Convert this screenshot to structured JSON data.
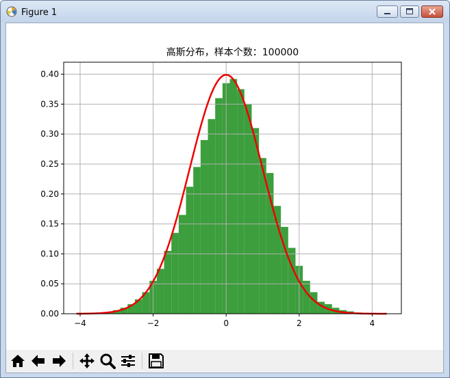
{
  "window": {
    "title": "Figure 1"
  },
  "toolbar": {
    "buttons": [
      {
        "name": "home",
        "icon": "home-icon"
      },
      {
        "name": "back",
        "icon": "arrow-left-icon"
      },
      {
        "name": "forward",
        "icon": "arrow-right-icon"
      },
      {
        "name": "pan",
        "icon": "move-icon"
      },
      {
        "name": "zoom",
        "icon": "magnifier-icon"
      },
      {
        "name": "configure-subplots",
        "icon": "sliders-icon"
      },
      {
        "name": "save",
        "icon": "floppy-icon"
      }
    ]
  },
  "colors": {
    "bars": "#3c9e3c",
    "curve": "#ee0000",
    "grid": "#b0b0b0"
  },
  "chart_data": {
    "type": "bar",
    "title": "高斯分布，样本个数：100000",
    "xlabel": "",
    "ylabel": "",
    "xlim": [
      -4.45,
      4.8
    ],
    "ylim": [
      0.0,
      0.42
    ],
    "xticks": [
      -4,
      -2,
      0,
      2,
      4
    ],
    "yticks": [
      0.0,
      0.05,
      0.1,
      0.15,
      0.2,
      0.25,
      0.3,
      0.35,
      0.4
    ],
    "ytick_labels": [
      "0.00",
      "0.05",
      "0.10",
      "0.15",
      "0.20",
      "0.25",
      "0.30",
      "0.35",
      "0.40"
    ],
    "grid": true,
    "bins": {
      "start": -4.1,
      "width": 0.2,
      "density": [
        0.0005,
        0.001,
        0.0015,
        0.002,
        0.003,
        0.006,
        0.01,
        0.016,
        0.024,
        0.036,
        0.055,
        0.075,
        0.105,
        0.135,
        0.165,
        0.212,
        0.245,
        0.29,
        0.325,
        0.36,
        0.385,
        0.392,
        0.375,
        0.35,
        0.31,
        0.26,
        0.235,
        0.18,
        0.145,
        0.11,
        0.08,
        0.055,
        0.036,
        0.02,
        0.016,
        0.01,
        0.006,
        0.004,
        0.002,
        0.0015,
        0.001,
        0.0005
      ]
    },
    "curve": {
      "name": "",
      "mean": 0,
      "std": 1,
      "x_range": [
        -4.1,
        4.4
      ]
    }
  }
}
